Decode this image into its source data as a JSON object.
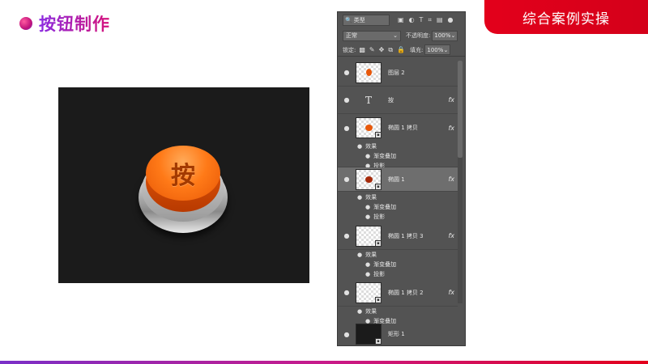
{
  "slide": {
    "title": "按钮制作",
    "banner": "综合案例实操"
  },
  "canvas": {
    "button_label": "按"
  },
  "colors": {
    "accent_red": "#e3001b",
    "title_purple": "#8a2be2",
    "button_orange": "#ff7a18",
    "panel_bg": "#535353",
    "canvas_bg": "#1b1b1b"
  },
  "panel": {
    "filter_label": "类型",
    "blend_mode": "正常",
    "opacity_label": "不透明度:",
    "opacity_value": "100%",
    "lock_label": "锁定:",
    "fill_label": "填充:",
    "fill_value": "100%",
    "layers": [
      {
        "name": "图层 2",
        "eye": "👁"
      },
      {
        "name": "按",
        "thumb_text": "T",
        "fx": "fx"
      },
      {
        "name": "椭圆 1 拷贝",
        "fx": "fx",
        "effects_label": "效果",
        "effects": [
          "渐变叠加",
          "投影"
        ]
      },
      {
        "name": "椭圆 1",
        "fx": "fx",
        "effects_label": "效果",
        "effects": [
          "渐变叠加",
          "投影"
        ]
      },
      {
        "name": "椭圆 1 拷贝 3",
        "fx": "fx",
        "effects_label": "效果",
        "effects": [
          "渐变叠加",
          "投影"
        ]
      },
      {
        "name": "椭圆 1 拷贝 2",
        "fx": "fx",
        "effects_label": "效果",
        "effects": [
          "渐变叠加"
        ]
      },
      {
        "name": "矩形 1"
      }
    ]
  }
}
